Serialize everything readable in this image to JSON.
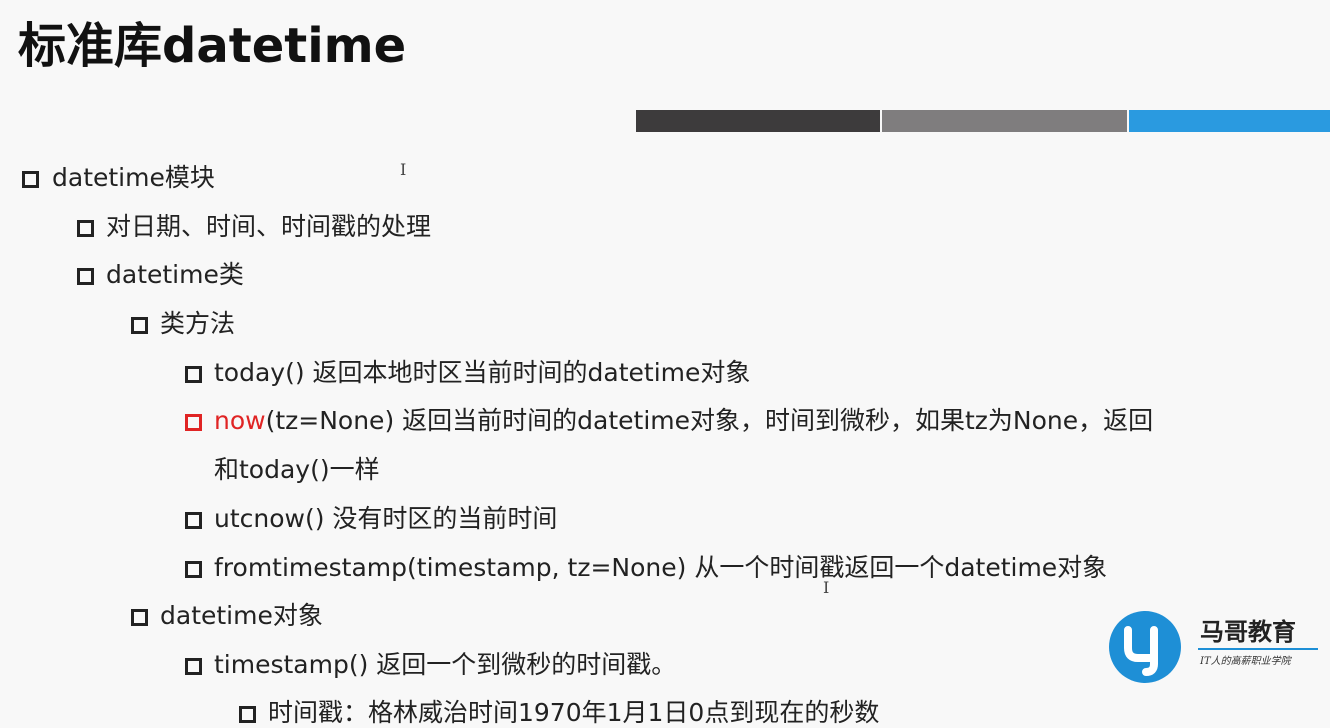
{
  "slide": {
    "title": "标准库datetime",
    "accent_colors": [
      "#3d3b3c",
      "#7f7d7e",
      "#2a9ae0"
    ]
  },
  "outline": {
    "l1_module": "datetime模块",
    "l2_processing": "对日期、时间、时间戳的处理",
    "l2_class": "datetime类",
    "l3_class_methods": "类方法",
    "l4_today": "today() 返回本地时区当前时间的datetime对象",
    "l4_now_keyword": "now",
    "l4_now_rest_line1": "(tz=None) 返回当前时间的datetime对象，时间到微秒，如果tz为None，返回",
    "l4_now_line2": "和today()一样",
    "l4_utcnow": "utcnow() 没有时区的当前时间",
    "l4_fromtimestamp": "fromtimestamp(timestamp, tz=None)  从一个时间戳返回一个datetime对象",
    "l3_object": "datetime对象",
    "l4_timestamp": "timestamp() 返回一个到微秒的时间戳。",
    "l5_epoch": "时间戳：格林威治时间1970年1月1日0点到现在的秒数"
  },
  "cursor_glyph": "I",
  "logo": {
    "name": "马哥教育",
    "tagline": "IT人的高薪职业学院",
    "brand_color": "#1e8fd6"
  }
}
